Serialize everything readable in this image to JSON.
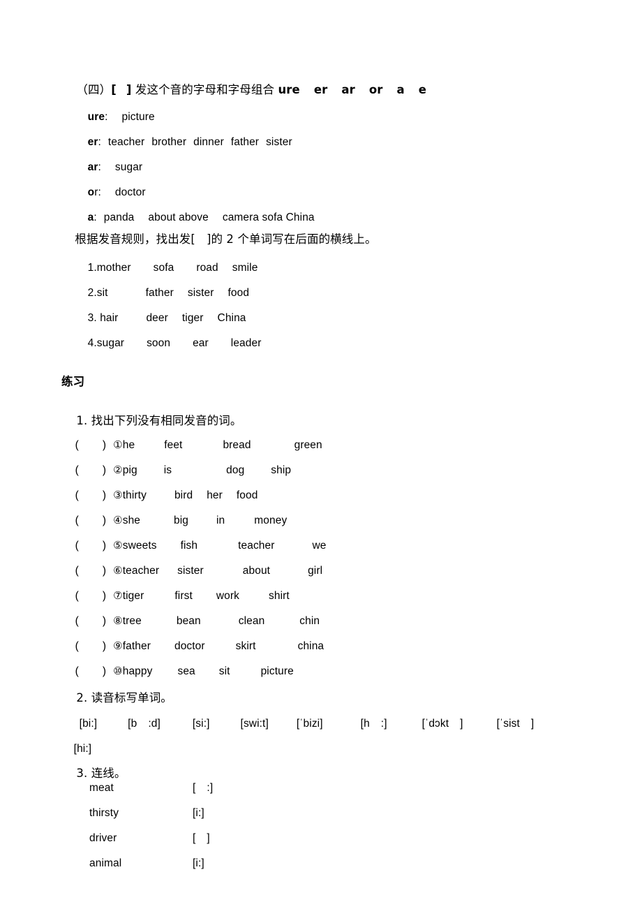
{
  "document": {
    "section_heading": {
      "label": "（四）",
      "bracket_open": "[",
      "bracket_close": "]",
      "text": "发这个音的字母和字母组合",
      "letters": [
        "ure",
        "er",
        "ar",
        "or",
        "a",
        "e"
      ]
    },
    "rules": [
      {
        "key": "ure",
        "key_bold_part": "ure",
        "key_plain_part": "",
        "colon": ":",
        "words": [
          "picture"
        ]
      },
      {
        "key": "er",
        "key_bold_part": "er",
        "key_plain_part": "",
        "colon": ":",
        "words": [
          "teacher",
          "brother",
          "dinner",
          "father",
          "sister"
        ]
      },
      {
        "key": "ar",
        "key_bold_part": "ar",
        "key_plain_part": "",
        "colon": ":",
        "words": [
          "sugar"
        ]
      },
      {
        "key": "or",
        "key_bold_part": "o",
        "key_plain_part": "r",
        "colon": ":",
        "words": [
          "doctor"
        ]
      },
      {
        "key": "a",
        "key_bold_part": "a",
        "key_plain_part": "",
        "colon": ":",
        "words": [
          "panda",
          "about above",
          "camera sofa China"
        ]
      }
    ],
    "instruction": {
      "before": "根据发音规则，找出发",
      "bracket_open": "[",
      "bracket_close": "]",
      "after": "的 2 个单词写在后面的横线上。"
    },
    "word_groups": [
      {
        "number": "1.",
        "words": [
          "mother",
          "sofa",
          "road",
          "smile"
        ]
      },
      {
        "number": "2.",
        "words": [
          "sit",
          "father",
          "sister",
          "food"
        ]
      },
      {
        "number": "3. ",
        "words": [
          "hair",
          "deer",
          "tiger",
          "China"
        ]
      },
      {
        "number": "4.",
        "words": [
          "sugar",
          "soon",
          "ear",
          "leader"
        ]
      }
    ],
    "exercises": {
      "heading": "练习",
      "q1": {
        "label": "1.",
        "prompt": "找出下列没有相同发音的词。",
        "items": [
          {
            "marker": "①",
            "words": [
              "he",
              "feet",
              "bread",
              "green"
            ]
          },
          {
            "marker": "②",
            "words": [
              "pig",
              "is",
              "dog",
              "ship"
            ]
          },
          {
            "marker": "③",
            "words": [
              "thirty",
              "bird",
              "her",
              "food"
            ]
          },
          {
            "marker": "④",
            "words": [
              "she",
              "big",
              "in",
              "money"
            ]
          },
          {
            "marker": "⑤",
            "words": [
              "sweets",
              "fish",
              "teacher",
              "we"
            ]
          },
          {
            "marker": "⑥",
            "words": [
              "teacher",
              "sister",
              "about",
              "girl"
            ]
          },
          {
            "marker": "⑦",
            "words": [
              "tiger",
              "first",
              "work",
              "shirt"
            ]
          },
          {
            "marker": "⑧",
            "words": [
              "tree",
              "bean",
              "clean",
              "chin"
            ]
          },
          {
            "marker": "⑨",
            "words": [
              "father",
              "doctor",
              "skirt",
              "china"
            ]
          },
          {
            "marker": "⑩",
            "words": [
              "happy",
              "sea",
              "sit",
              "picture"
            ]
          }
        ]
      },
      "q2": {
        "label": "2.",
        "prompt": "读音标写单词。",
        "transcriptions_row1": [
          {
            "open": "[",
            "pre": "bi:",
            "gap": false,
            "post": "",
            "close": "]"
          },
          {
            "open": "[",
            "pre": "b",
            "gap": true,
            "post": ":d",
            "close": "]"
          },
          {
            "open": "[",
            "pre": "si:",
            "gap": false,
            "post": "",
            "close": "]"
          },
          {
            "open": "[",
            "pre": "swi:t",
            "gap": false,
            "post": "",
            "close": "]"
          },
          {
            "open": "[",
            "pre": "ˈbizi",
            "gap": false,
            "post": "",
            "close": "]"
          },
          {
            "open": "[",
            "pre": "h",
            "gap": true,
            "post": ":",
            "close": "]"
          },
          {
            "open": "[",
            "pre": "ˈdɔkt",
            "gap": true,
            "post": "",
            "close": "]"
          },
          {
            "open": "[",
            "pre": "ˈsist",
            "gap": true,
            "post": "",
            "close": "]"
          }
        ],
        "transcriptions_row2": [
          {
            "open": "[",
            "pre": "hi:",
            "gap": false,
            "post": "",
            "close": "]"
          }
        ]
      },
      "q3": {
        "label": "3.",
        "prompt": "连线。",
        "pairs": [
          {
            "word": "meat",
            "symbol_open": "[",
            "symbol_gap": true,
            "symbol_text": ":",
            "symbol_close": "]"
          },
          {
            "word": "thirsty",
            "symbol_open": "[",
            "symbol_gap": false,
            "symbol_text": "i:",
            "symbol_close": "]"
          },
          {
            "word": "driver",
            "symbol_open": "[",
            "symbol_gap": true,
            "symbol_text": "",
            "symbol_close": "]"
          },
          {
            "word": "animal",
            "symbol_open": "[",
            "symbol_gap": false,
            "symbol_text": "i:",
            "symbol_close": "]"
          }
        ]
      }
    }
  }
}
